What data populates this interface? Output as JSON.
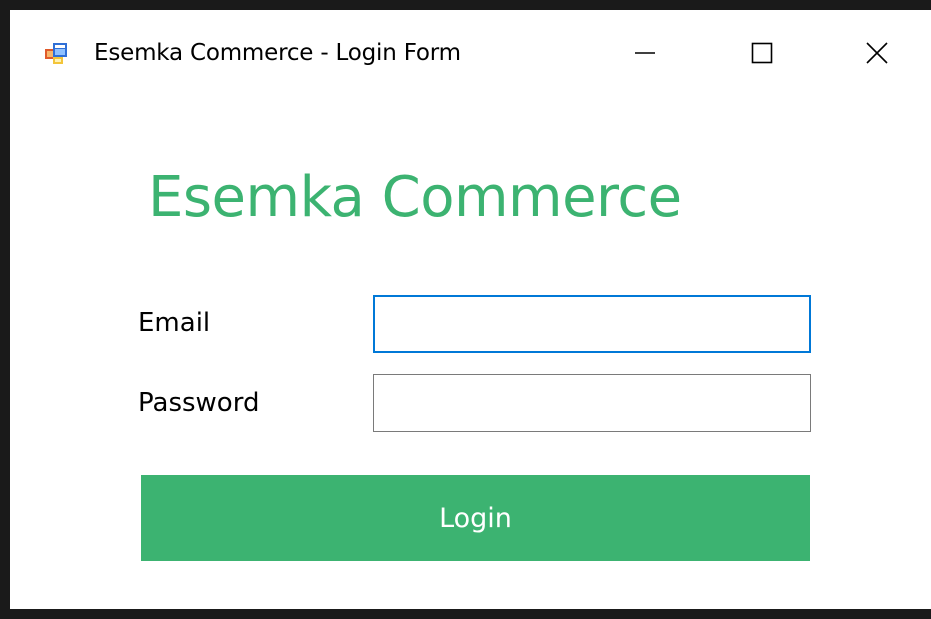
{
  "window": {
    "title": "Esemka Commerce - Login Form",
    "icon": "winforms-app-icon",
    "controls": {
      "minimize_icon": "minimize-icon",
      "maximize_icon": "maximize-icon",
      "close_icon": "close-icon"
    }
  },
  "form": {
    "heading": "Esemka Commerce",
    "email_label": "Email",
    "email_value": "",
    "password_label": "Password",
    "password_value": "",
    "login_label": "Login"
  },
  "colors": {
    "accent": "#3cb371",
    "focus_border": "#0078d7",
    "input_border": "#7a7a7a",
    "button_text": "#ffffff"
  }
}
